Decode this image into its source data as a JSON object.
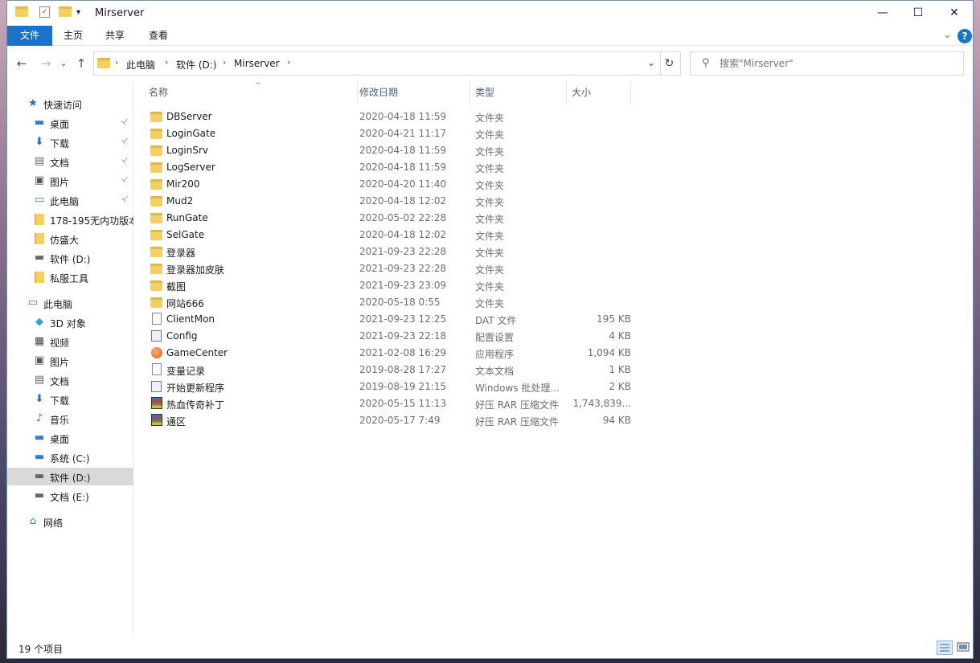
{
  "window": {
    "title": "Mirserver",
    "minimize": "—",
    "maximize": "☐",
    "close": "✕"
  },
  "ribbon": {
    "tabs": [
      {
        "label": "文件",
        "active": true
      },
      {
        "label": "主页"
      },
      {
        "label": "共享"
      },
      {
        "label": "查看"
      }
    ],
    "help": "?",
    "expand": "⌄"
  },
  "address": {
    "crumbs": [
      "此电脑",
      "软件 (D:)",
      "Mirserver"
    ],
    "separator": "›",
    "dropdown": "⌄",
    "refresh": "↻"
  },
  "nav": {
    "back": "←",
    "forward": "→",
    "recent": "⌄",
    "up": "↑"
  },
  "search": {
    "placeholder": "搜索\"Mirserver\""
  },
  "sidebar": {
    "items": [
      {
        "label": "快速访问",
        "icon": "star-icon",
        "pinned": false,
        "indent": 0
      },
      {
        "label": "桌面",
        "icon": "desktop-icon",
        "pinned": true,
        "indent": 1
      },
      {
        "label": "下载",
        "icon": "download-icon",
        "pinned": true,
        "indent": 1
      },
      {
        "label": "文档",
        "icon": "document-icon",
        "pinned": true,
        "indent": 1
      },
      {
        "label": "图片",
        "icon": "picture-icon",
        "pinned": true,
        "indent": 1
      },
      {
        "label": "此电脑",
        "icon": "computer-icon",
        "pinned": true,
        "indent": 1
      },
      {
        "label": "178-195无内功版本",
        "icon": "folder-icon",
        "pinned": false,
        "indent": 1
      },
      {
        "label": "仿盛大",
        "icon": "folder-icon",
        "pinned": false,
        "indent": 1
      },
      {
        "label": "软件 (D:)",
        "icon": "drive-icon",
        "pinned": false,
        "indent": 1
      },
      {
        "label": "私服工具",
        "icon": "folder-icon",
        "pinned": false,
        "indent": 1
      },
      {
        "label": "此电脑",
        "icon": "computer-icon",
        "pinned": false,
        "indent": 0
      },
      {
        "label": "3D 对象",
        "icon": "cube-icon",
        "pinned": false,
        "indent": 1
      },
      {
        "label": "视频",
        "icon": "video-icon",
        "pinned": false,
        "indent": 1
      },
      {
        "label": "图片",
        "icon": "picture-icon",
        "pinned": false,
        "indent": 1
      },
      {
        "label": "文档",
        "icon": "document-icon",
        "pinned": false,
        "indent": 1
      },
      {
        "label": "下载",
        "icon": "download-icon",
        "pinned": false,
        "indent": 1
      },
      {
        "label": "音乐",
        "icon": "music-icon",
        "pinned": false,
        "indent": 1
      },
      {
        "label": "桌面",
        "icon": "desktop-icon",
        "pinned": false,
        "indent": 1
      },
      {
        "label": "系统 (C:)",
        "icon": "system-drive-icon",
        "pinned": false,
        "indent": 1
      },
      {
        "label": "软件 (D:)",
        "icon": "drive-icon",
        "pinned": false,
        "indent": 1,
        "selected": true
      },
      {
        "label": "文档 (E:)",
        "icon": "drive-icon",
        "pinned": false,
        "indent": 1
      },
      {
        "label": "网络",
        "icon": "network-icon",
        "pinned": false,
        "indent": 0
      }
    ],
    "pin_glyph": "📌"
  },
  "columns": {
    "name": "名称",
    "date": "修改日期",
    "type": "类型",
    "size": "大小",
    "sort_arrow": "^"
  },
  "files": [
    {
      "name": "DBServer",
      "date": "2020-04-18 11:59",
      "type": "文件夹",
      "size": "",
      "icon": "folder"
    },
    {
      "name": "LoginGate",
      "date": "2020-04-21 11:17",
      "type": "文件夹",
      "size": "",
      "icon": "folder"
    },
    {
      "name": "LoginSrv",
      "date": "2020-04-18 11:59",
      "type": "文件夹",
      "size": "",
      "icon": "folder"
    },
    {
      "name": "LogServer",
      "date": "2020-04-18 11:59",
      "type": "文件夹",
      "size": "",
      "icon": "folder"
    },
    {
      "name": "Mir200",
      "date": "2020-04-20 11:40",
      "type": "文件夹",
      "size": "",
      "icon": "folder"
    },
    {
      "name": "Mud2",
      "date": "2020-04-18 12:02",
      "type": "文件夹",
      "size": "",
      "icon": "folder"
    },
    {
      "name": "RunGate",
      "date": "2020-05-02 22:28",
      "type": "文件夹",
      "size": "",
      "icon": "folder"
    },
    {
      "name": "SelGate",
      "date": "2020-04-18 12:02",
      "type": "文件夹",
      "size": "",
      "icon": "folder"
    },
    {
      "name": "登录器",
      "date": "2021-09-23 22:28",
      "type": "文件夹",
      "size": "",
      "icon": "folder"
    },
    {
      "name": "登录器加皮肤",
      "date": "2021-09-23 22:28",
      "type": "文件夹",
      "size": "",
      "icon": "folder"
    },
    {
      "name": "截图",
      "date": "2021-09-23 23:09",
      "type": "文件夹",
      "size": "",
      "icon": "folder"
    },
    {
      "name": "网站666",
      "date": "2020-05-18 0:55",
      "type": "文件夹",
      "size": "",
      "icon": "folder"
    },
    {
      "name": "ClientMon",
      "date": "2021-09-23 12:25",
      "type": "DAT 文件",
      "size": "195 KB",
      "icon": "file"
    },
    {
      "name": "Config",
      "date": "2021-09-23 22:18",
      "type": "配置设置",
      "size": "4 KB",
      "icon": "bat"
    },
    {
      "name": "GameCenter",
      "date": "2021-02-08 16:29",
      "type": "应用程序",
      "size": "1,094 KB",
      "icon": "exe"
    },
    {
      "name": "变量记录",
      "date": "2019-08-28 17:27",
      "type": "文本文档",
      "size": "1 KB",
      "icon": "file"
    },
    {
      "name": "开始更新程序",
      "date": "2019-08-19 21:15",
      "type": "Windows 批处理...",
      "size": "2 KB",
      "icon": "bat"
    },
    {
      "name": "热血传奇补丁",
      "date": "2020-05-15 11:13",
      "type": "好压 RAR 压缩文件",
      "size": "1,743,839...",
      "icon": "rar"
    },
    {
      "name": "通区",
      "date": "2020-05-17 7:49",
      "type": "好压 RAR 压缩文件",
      "size": "94 KB",
      "icon": "rar"
    }
  ],
  "status": {
    "count": "19 个项目"
  }
}
